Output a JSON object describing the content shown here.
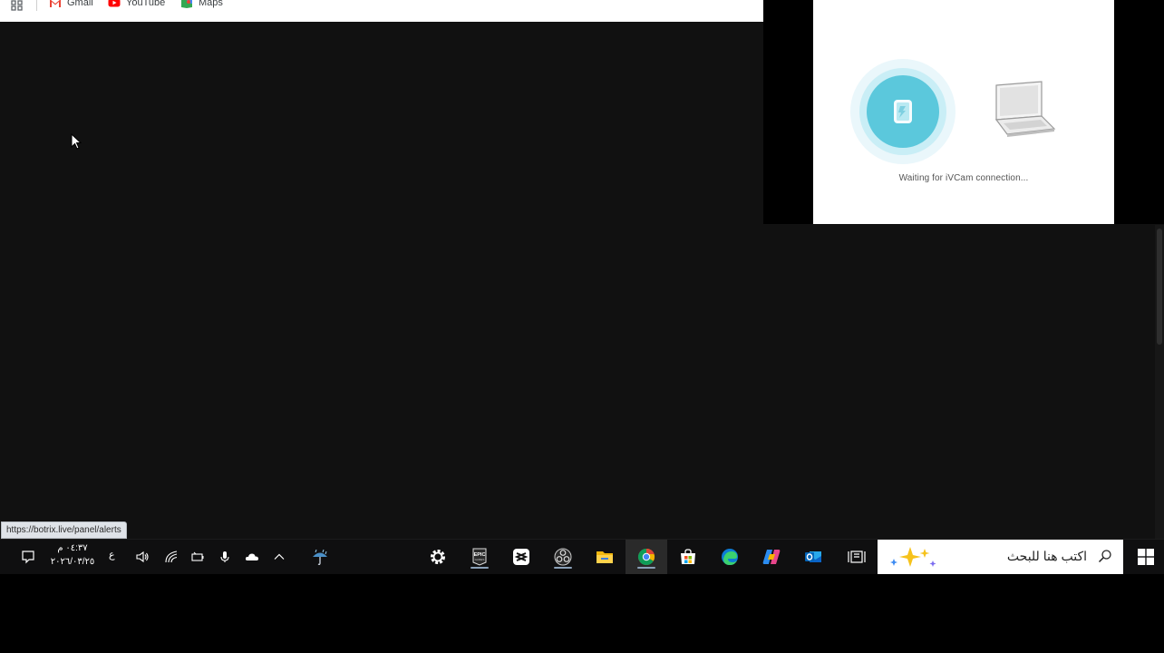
{
  "bookmarks": [
    {
      "label": "Gmail",
      "icon": "gmail-icon"
    },
    {
      "label": "YouTube",
      "icon": "youtube-icon"
    },
    {
      "label": "Maps",
      "icon": "maps-icon"
    }
  ],
  "ivcam": {
    "status_text": "Waiting for iVCam connection..."
  },
  "status_bar": {
    "url": "https://botrix.live/panel/alerts"
  },
  "taskbar": {
    "time": "٠٤:٣٧ م",
    "date": "٢٠٢٦/٠٣/٢٥",
    "language": "ع",
    "search_placeholder": "اكتب هنا للبحث",
    "tray_icons": [
      "notification-icon",
      "volume-icon",
      "network-icon",
      "battery-icon",
      "microphone-icon",
      "onedrive-icon",
      "show-hidden-icons-chevron",
      "weather-icon"
    ],
    "pinned_apps": [
      "settings-icon",
      "epic-games-icon",
      "capcut-icon",
      "obs-icon",
      "file-explorer-icon",
      "chrome-icon",
      "microsoft-store-icon",
      "edge-icon",
      "copilot-icon",
      "outlook-icon",
      "task-view-icon"
    ]
  },
  "colors": {
    "browser_bg": "#111111",
    "taskbar_bg": "#0f0f10",
    "ivcam_accent": "#5bc8dc"
  }
}
